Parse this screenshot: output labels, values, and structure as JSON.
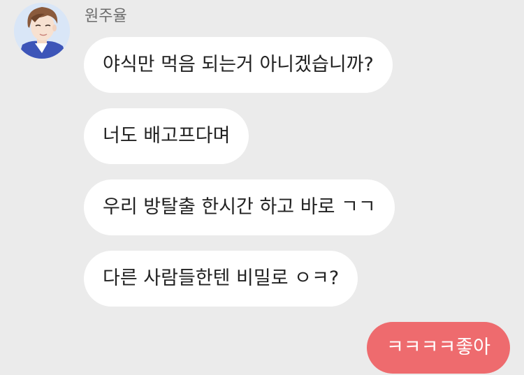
{
  "contact": {
    "name": "원주율",
    "avatar_icon": "profile-avatar-icon"
  },
  "messages": [
    {
      "sender": "원주율",
      "direction": "incoming",
      "text": "야식만 먹음 되는거 아니겠습니까?"
    },
    {
      "sender": "원주율",
      "direction": "incoming",
      "text": "너도 배고프다며"
    },
    {
      "sender": "원주율",
      "direction": "incoming",
      "text": "우리 방탈출 한시간 하고 바로 ㄱㄱ"
    },
    {
      "sender": "원주율",
      "direction": "incoming",
      "text": "다른 사람들한텐 비밀로 ㅇㅋ?"
    },
    {
      "sender": "me",
      "direction": "outgoing",
      "text": "ㅋㅋㅋㅋ좋아"
    }
  ],
  "colors": {
    "background": "#ebebeb",
    "incoming_bubble": "#ffffff",
    "outgoing_bubble": "#ee6b6e",
    "incoming_text": "#222222",
    "outgoing_text": "#ffffff",
    "sender_name": "#6b6b6b"
  }
}
